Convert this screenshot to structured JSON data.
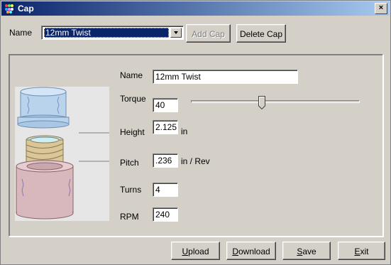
{
  "window": {
    "title": "Cap",
    "close_glyph": "×"
  },
  "selector": {
    "label": "Name",
    "selected": "12mm Twist",
    "add_label": "Add Cap",
    "delete_label": "Delete Cap"
  },
  "form": {
    "name": {
      "label": "Name",
      "value": "12mm Twist"
    },
    "torque": {
      "label": "Torque",
      "value": "40",
      "slider_fraction": 0.42
    },
    "height": {
      "label": "Height",
      "value": "2.125",
      "unit": "in"
    },
    "pitch": {
      "label": "Pitch",
      "value": ".236",
      "unit": "in / Rev"
    },
    "turns": {
      "label": "Turns",
      "value": "4"
    },
    "rpm": {
      "label": "RPM",
      "value": "240"
    }
  },
  "buttons": {
    "upload": {
      "first": "U",
      "rest": "pload"
    },
    "download": {
      "first": "D",
      "rest": "ownload"
    },
    "save": {
      "first": "S",
      "rest": "ave"
    },
    "exit": {
      "first": "E",
      "rest": "xit"
    }
  },
  "colors": {
    "title_start": "#0a246a",
    "title_end": "#a6caf0",
    "face": "#d4d0c8",
    "cap_blue": "#b9d3ec",
    "thread_tan": "#d9c79a",
    "bottle_pink": "#d8b8bd"
  }
}
